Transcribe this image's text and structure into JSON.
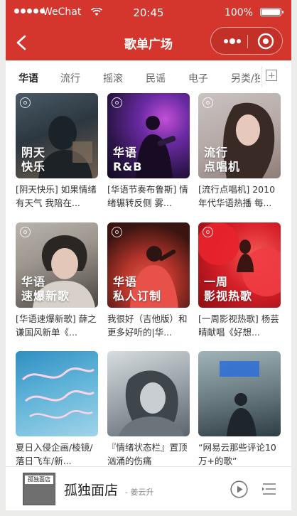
{
  "status_bar": {
    "carrier": "WeChat",
    "time": "20:45",
    "battery": "100%"
  },
  "nav": {
    "title": "歌单广场"
  },
  "tabs": [
    "华语",
    "流行",
    "摇滚",
    "民谣",
    "电子",
    "另类/独立"
  ],
  "active_tab": 0,
  "playlists": [
    {
      "cover_text": [
        "阴天",
        "快乐"
      ],
      "title": "[阴天快乐] 如果情绪有天气 我陪在..."
    },
    {
      "cover_text": [
        "华语",
        "R&B"
      ],
      "title": "[华语节奏布鲁斯] 情绪辗转反侧 雾..."
    },
    {
      "cover_text": [
        "流行",
        "点唱机"
      ],
      "title": "[流行点唱机] 2010年代华语热播 每..."
    },
    {
      "cover_text": [
        "华语",
        "速爆新歌"
      ],
      "title": "[华语速爆新歌] 薛之谦国风新单《..."
    },
    {
      "cover_text": [
        "华语",
        "私人订制"
      ],
      "title": "我很好（吉他版）和更多好听的|华..."
    },
    {
      "cover_text": [
        "一周",
        "影视热歌"
      ],
      "title": "[一周影视热歌] 杨芸晴献唱《好想..."
    },
    {
      "cover_text": [],
      "title": "夏日入侵企画/棱镜/落日飞车/新..."
    },
    {
      "cover_text": [],
      "title": "『情绪状态栏』置顶汹涌的伤痛"
    },
    {
      "cover_text": [],
      "title": "“网易云那些评论10万+的歌”"
    }
  ],
  "player": {
    "thumb_label": "孤独面店",
    "song": "孤独面店",
    "artist": "- 姜云升"
  },
  "colors": {
    "brand": "#d4352c"
  }
}
